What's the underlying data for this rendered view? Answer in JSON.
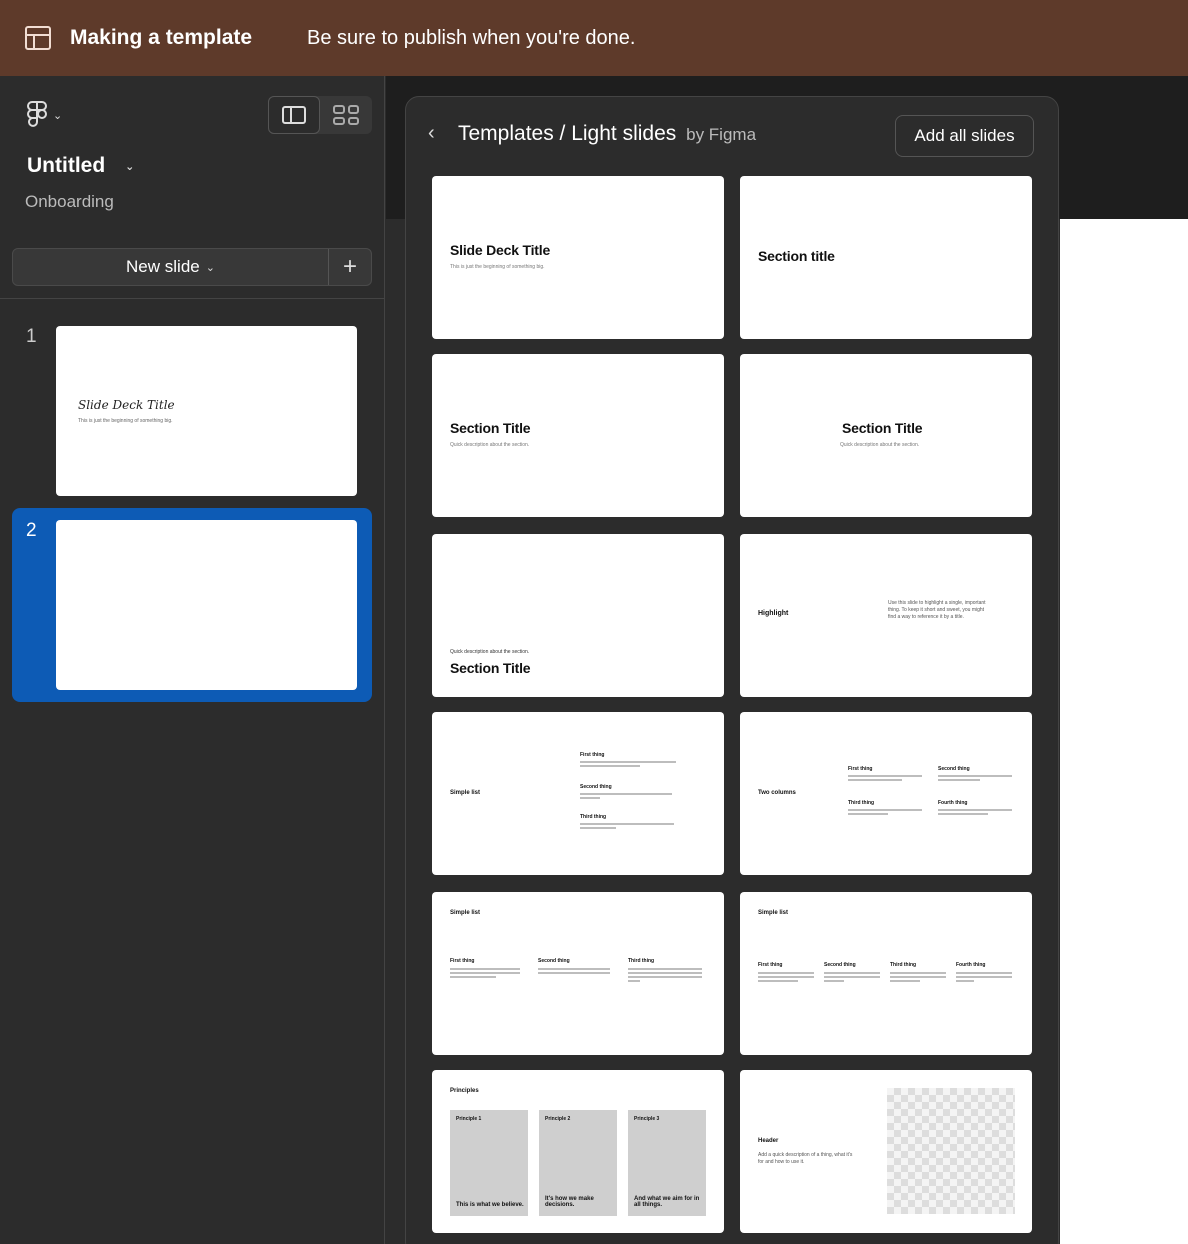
{
  "banner": {
    "title": "Making a template",
    "message": "Be sure to publish when you're done."
  },
  "sidebar": {
    "doc_title": "Untitled",
    "doc_subtitle": "Onboarding",
    "new_slide_label": "New slide",
    "add_glyph": "+",
    "chevron_glyph": "⌄",
    "slides": [
      {
        "number": "1",
        "thumb_title": "Slide Deck Title",
        "thumb_sub": "This is just the beginning of something big."
      },
      {
        "number": "2"
      }
    ]
  },
  "panel": {
    "back_glyph": "‹",
    "title": "Templates / Light slides",
    "by": "by Figma",
    "add_all_label": "Add all slides",
    "templates": [
      {
        "title": "Slide Deck Title",
        "sub": "This is just the beginning of something big."
      },
      {
        "title": "Section title"
      },
      {
        "title": "Section Title",
        "sub": "Quick description about the section."
      },
      {
        "title": "Section Title",
        "sub": "Quick description about the section."
      },
      {
        "title": "Section Title",
        "sub": "Quick description about the section."
      },
      {
        "title": "Highlight",
        "body": "Use this slide to highlight a single, important thing. To keep it short and sweet, you might find a way to reference it by a title."
      },
      {
        "title": "Simple list",
        "items": [
          "First thing",
          "Second thing",
          "Third thing"
        ]
      },
      {
        "title": "Two columns",
        "items": [
          "First thing",
          "Second thing",
          "Third thing",
          "Fourth thing"
        ]
      },
      {
        "title": "Simple list",
        "items": [
          "First thing",
          "Second thing",
          "Third thing"
        ]
      },
      {
        "title": "Simple list",
        "items": [
          "First thing",
          "Second thing",
          "Third thing",
          "Fourth thing"
        ]
      },
      {
        "title": "Principles",
        "items": [
          {
            "label": "Principle 1",
            "text": "This is what we believe."
          },
          {
            "label": "Principle 2",
            "text": "It's how we make decisions."
          },
          {
            "label": "Principle 3",
            "text": "And what we aim for in all things."
          }
        ]
      },
      {
        "title": "Header",
        "sub": "Add a quick description of a thing, what it's for and how to use it."
      }
    ]
  }
}
